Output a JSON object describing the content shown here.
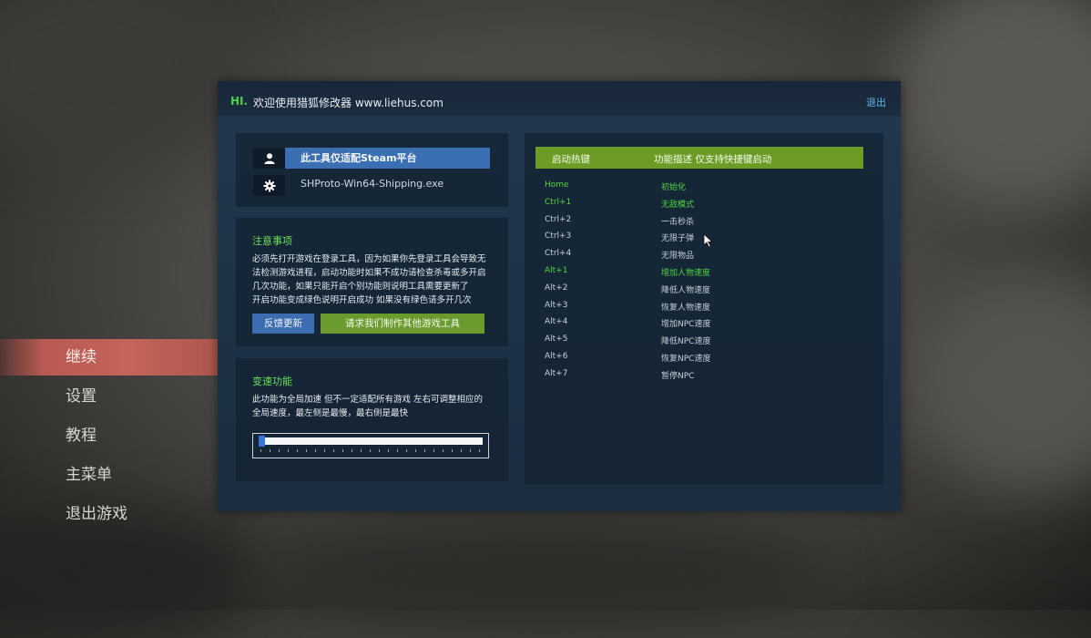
{
  "game_menu": {
    "items": [
      {
        "label": "继续",
        "active": true
      },
      {
        "label": "设置",
        "active": false
      },
      {
        "label": "教程",
        "active": false
      },
      {
        "label": "主菜单",
        "active": false
      },
      {
        "label": "退出游戏",
        "active": false
      }
    ]
  },
  "trainer": {
    "greeting": "HI.",
    "title": "欢迎使用猎狐修改器 www.liehus.com",
    "exit_label": "退出",
    "platform": {
      "user_icon": "user-icon",
      "platform_label": "此工具仅适配Steam平台",
      "gear_icon": "gear-icon",
      "exe_name": "SHProto-Win64-Shipping.exe"
    },
    "notice": {
      "title": "注意事项",
      "lines": [
        "必须先打开游戏在登录工具，因为如果你先登录工具会导致无",
        "法检测游戏进程，启动功能时如果不成功请检查杀毒或多开启",
        "几次功能，如果只能开启个别功能则说明工具需要更新了",
        "开启功能变成绿色说明开启成功 如果没有绿色请多开几次"
      ],
      "feedback_button": "反馈更新",
      "request_button": "请求我们制作其他游戏工具"
    },
    "speed": {
      "title": "变速功能",
      "lines": [
        "此功能为全局加速 但不一定适配所有游戏 左右可调整相应的",
        "全局速度，最左侧是最慢，最右侧是最快"
      ],
      "slider_value": 0.0
    },
    "hotkeys": {
      "header_key": "启动热键",
      "header_desc": "功能描述 仅支持快捷键启动",
      "active_color": "#4fd53f",
      "rows": [
        {
          "key": "Home",
          "desc": "初始化",
          "on": true
        },
        {
          "key": "Ctrl+1",
          "desc": "无敌模式",
          "on": true
        },
        {
          "key": "Ctrl+2",
          "desc": "一击秒杀",
          "on": false
        },
        {
          "key": "Ctrl+3",
          "desc": "无限子弹",
          "on": false
        },
        {
          "key": "Ctrl+4",
          "desc": "无限物品",
          "on": false
        },
        {
          "key": "Alt+1",
          "desc": "增加人物速度",
          "on": true
        },
        {
          "key": "Alt+2",
          "desc": "降低人物速度",
          "on": false
        },
        {
          "key": "Alt+3",
          "desc": "恢复人物速度",
          "on": false
        },
        {
          "key": "Alt+4",
          "desc": "增加NPC速度",
          "on": false
        },
        {
          "key": "Alt+5",
          "desc": "降低NPC速度",
          "on": false
        },
        {
          "key": "Alt+6",
          "desc": "恢复NPC速度",
          "on": false
        },
        {
          "key": "Alt+7",
          "desc": "暂停NPC",
          "on": false
        }
      ]
    }
  }
}
